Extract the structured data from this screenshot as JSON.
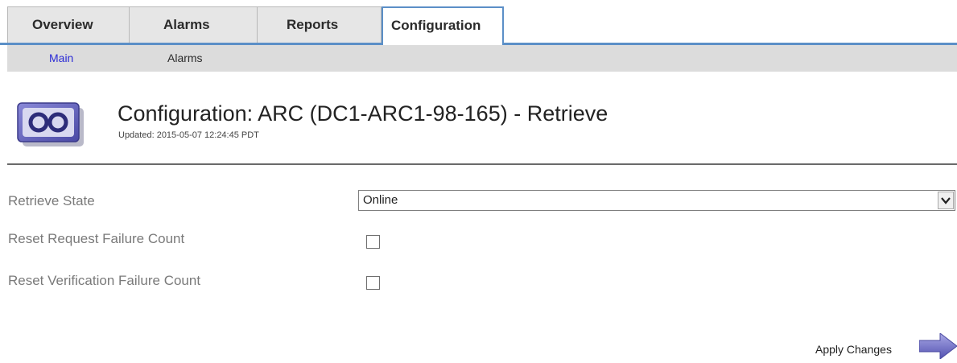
{
  "tabs": [
    {
      "label": "Overview",
      "active": false
    },
    {
      "label": "Alarms",
      "active": false
    },
    {
      "label": "Reports",
      "active": false
    },
    {
      "label": "Configuration",
      "active": true
    }
  ],
  "subnav": [
    {
      "label": "Main",
      "active": true
    },
    {
      "label": "Alarms",
      "active": false
    }
  ],
  "header": {
    "title": "Configuration: ARC (DC1-ARC1-98-165) - Retrieve",
    "updated": "Updated: 2015-05-07 12:24:45 PDT",
    "icon": "archive-node-icon"
  },
  "form": {
    "retrieve_state_label": "Retrieve State",
    "retrieve_state_value": "Online",
    "reset_request_label": "Reset Request Failure Count",
    "reset_request_checked": false,
    "reset_verification_label": "Reset Verification Failure Count",
    "reset_verification_checked": false
  },
  "apply": {
    "label": "Apply Changes",
    "icon": "arrow-right-icon"
  },
  "colors": {
    "tab_accent": "#5b8fc7",
    "subnav_bg": "#dcdcdc",
    "active_link": "#2b2bd6",
    "label_gray": "#7a7a7a",
    "icon_purple": "#5b5ab5"
  }
}
